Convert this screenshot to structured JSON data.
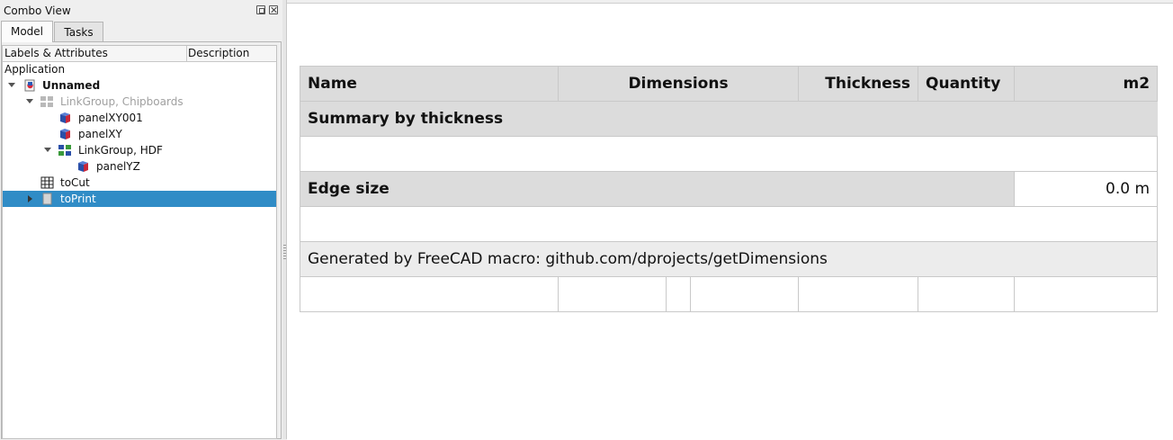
{
  "combo": {
    "title": "Combo View",
    "tabs": [
      "Model",
      "Tasks"
    ],
    "tree_header": {
      "labels": "Labels & Attributes",
      "description": "Description"
    },
    "tree": {
      "root": "Application",
      "document": "Unnamed",
      "items": [
        {
          "label": "LinkGroup, Chipboards",
          "icon": "link-group-icon",
          "dimmed": true
        },
        {
          "label": "panelXY001",
          "icon": "part-box-icon"
        },
        {
          "label": "panelXY",
          "icon": "part-box-icon"
        },
        {
          "label": "LinkGroup, HDF",
          "icon": "link-group-icon"
        },
        {
          "label": "panelYZ",
          "icon": "part-box-icon"
        },
        {
          "label": "toCut",
          "icon": "spreadsheet-icon"
        },
        {
          "label": "toPrint",
          "icon": "page-icon",
          "selected": true
        }
      ]
    }
  },
  "report": {
    "header": [
      "Name",
      "Dimensions",
      "Thickness",
      "Quantity",
      "m2"
    ],
    "summary_title": "Summary by thickness",
    "edge_label": "Edge size",
    "edge_value": "0.0 m",
    "generated": "Generated by FreeCAD macro: github.com/dprojects/getDimensions"
  },
  "colors": {
    "selection": "#308cc6",
    "header_bg": "#dcdcdc",
    "dim_text": "#a0a0a0"
  }
}
